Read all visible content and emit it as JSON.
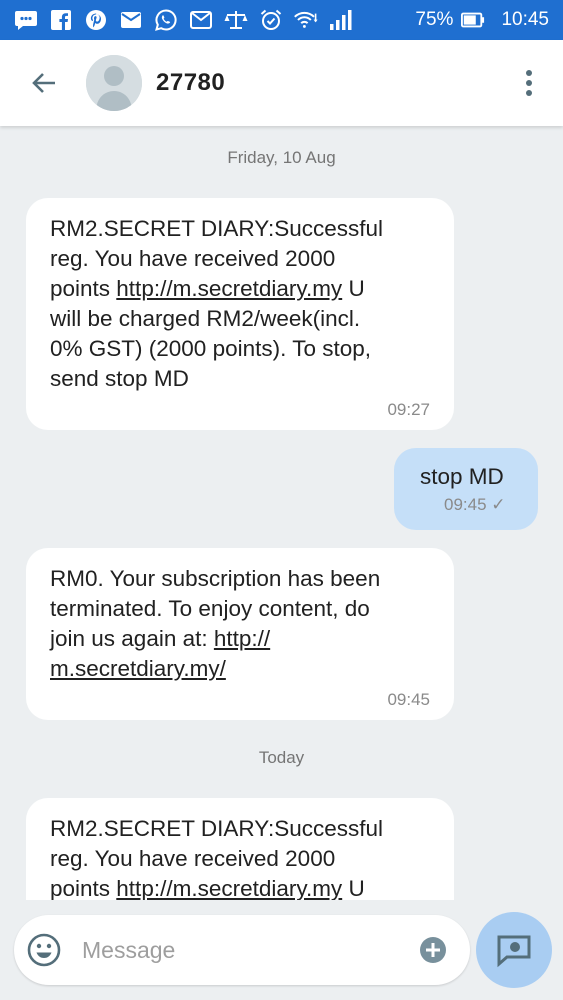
{
  "status_bar": {
    "battery_percent": "75%",
    "time": "10:45",
    "icons": [
      "chat-icon",
      "facebook-icon",
      "pinterest-icon",
      "mail-icon",
      "whatsapp-icon",
      "gmail-icon",
      "scales-icon",
      "alarm-icon",
      "wifi-icon",
      "signal-icon",
      "battery-icon"
    ]
  },
  "header": {
    "contact_name": "27780",
    "back_icon": "arrow-back-icon",
    "menu_icon": "more-vert-icon"
  },
  "thread": {
    "date_friday": "Friday, 10 Aug",
    "date_today": "Today",
    "messages": [
      {
        "direction": "incoming",
        "text_before": "RM2.SECRET DIARY:Successful\nreg. You have received 2000\npoints ",
        "link": "http://m.secretdiary.my",
        "text_after": " U\nwill be charged RM2/week(incl.\n0% GST) (2000 points). To stop,\nsend stop MD",
        "time": "09:27"
      },
      {
        "direction": "outgoing",
        "text": "stop MD",
        "time": "09:45",
        "status": "✓"
      },
      {
        "direction": "incoming",
        "text_before": "RM0. Your subscription has been\nterminated. To enjoy  content, do\njoin us again at: ",
        "link": "http://\nm.secretdiary.my/",
        "text_after": "",
        "time": "09:45"
      },
      {
        "direction": "incoming",
        "text_before": "RM2.SECRET DIARY:Successful\nreg. You have received 2000\npoints ",
        "link": "http://m.secretdiary.my",
        "text_after": " U"
      }
    ]
  },
  "composer": {
    "placeholder": "Message",
    "emoji_icon": "emoji-icon",
    "attach_icon": "add-attachment-icon",
    "send_icon": "sms-send-icon"
  },
  "colors": {
    "status_bar": "#1f6fd0",
    "app_bar": "#ffffff",
    "background": "#eceff1",
    "incoming_bubble": "#ffffff",
    "outgoing_bubble": "#c5dff8",
    "send_button": "#a9cdf2"
  }
}
